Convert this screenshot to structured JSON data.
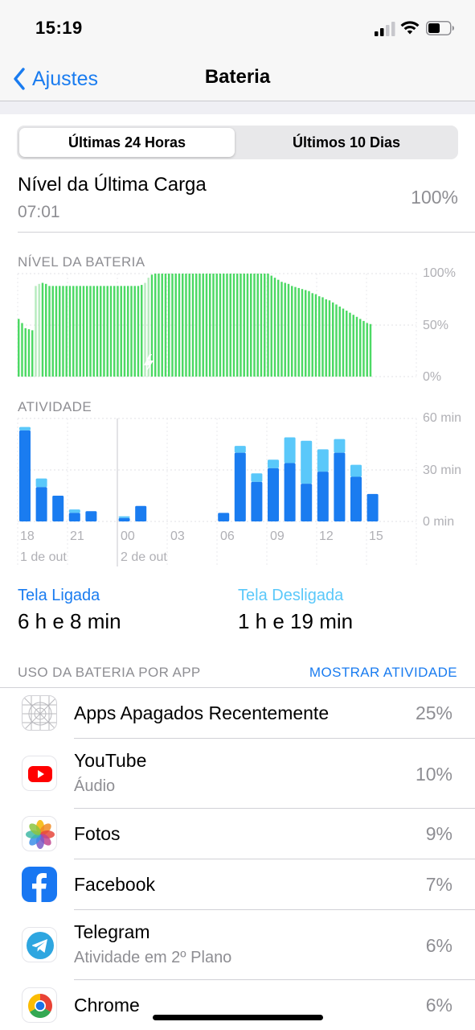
{
  "status": {
    "time": "15:19"
  },
  "nav": {
    "back_label": "Ajustes",
    "title": "Bateria"
  },
  "segments": {
    "active": "Últimas 24 Horas",
    "inactive": "Últimos 10 Dias"
  },
  "last_charge": {
    "title": "Nível da Última Carga",
    "time": "07:01",
    "value": "100%"
  },
  "battery_chart": {
    "section_label": "NÍVEL DA BATERIA",
    "y_labels": [
      "100%",
      "50%",
      "0%"
    ]
  },
  "activity_chart": {
    "section_label": "ATIVIDADE",
    "y_labels": [
      "60 min",
      "30 min",
      "0 min"
    ],
    "x_labels": [
      "18",
      "21",
      "00",
      "03",
      "06",
      "09",
      "12",
      "15"
    ],
    "date_labels": [
      "1 de out",
      "2 de out"
    ]
  },
  "usage": {
    "screen_on_label": "Tela Ligada",
    "screen_on_value": "6 h e 8 min",
    "screen_off_label": "Tela Desligada",
    "screen_off_value": "1 h e 19 min"
  },
  "apps_section": {
    "header": "USO DA BATERIA POR APP",
    "action": "MOSTRAR ATIVIDADE"
  },
  "apps": [
    {
      "name": "Apps Apagados Recentemente",
      "sub": "",
      "pct": "25%",
      "icon": "deleted-apps-icon"
    },
    {
      "name": "YouTube",
      "sub": "Áudio",
      "pct": "10%",
      "icon": "youtube-icon"
    },
    {
      "name": "Fotos",
      "sub": "",
      "pct": "9%",
      "icon": "photos-icon"
    },
    {
      "name": "Facebook",
      "sub": "",
      "pct": "7%",
      "icon": "facebook-icon"
    },
    {
      "name": "Telegram",
      "sub": "Atividade em 2º Plano",
      "pct": "6%",
      "icon": "telegram-icon"
    },
    {
      "name": "Chrome",
      "sub": "",
      "pct": "6%",
      "icon": "chrome-icon"
    }
  ],
  "colors": {
    "accent": "#1a7cf0",
    "battery_green": "#4cd964",
    "screen_on": "#1a7cf0",
    "screen_off": "#5ac8fa"
  },
  "chart_data": [
    {
      "type": "bar",
      "title": "NÍVEL DA BATERIA",
      "ylim": [
        0,
        100
      ],
      "y_ticks": [
        "100%",
        "50%",
        "0%"
      ],
      "note_charging": "charging periods around bars 5-6 and 37-38",
      "values": [
        56,
        52,
        47,
        46,
        45,
        88,
        90,
        91,
        90,
        88,
        88,
        88,
        88,
        88,
        88,
        88,
        88,
        88,
        88,
        88,
        88,
        88,
        88,
        88,
        88,
        88,
        88,
        88,
        88,
        88,
        88,
        88,
        88,
        88,
        88,
        88,
        89,
        91,
        96,
        99,
        100,
        100,
        100,
        100,
        100,
        100,
        100,
        100,
        100,
        100,
        100,
        100,
        100,
        100,
        100,
        100,
        100,
        100,
        100,
        100,
        100,
        100,
        100,
        100,
        100,
        100,
        100,
        100,
        100,
        100,
        100,
        100,
        100,
        100,
        98,
        96,
        94,
        92,
        91,
        90,
        88,
        87,
        86,
        85,
        84,
        83,
        81,
        80,
        78,
        77,
        75,
        74,
        72,
        70,
        68,
        66,
        64,
        62,
        60,
        58,
        56,
        54,
        52,
        51
      ]
    },
    {
      "type": "bar",
      "title": "ATIVIDADE",
      "ylim": [
        0,
        60
      ],
      "categories": [
        "18",
        "19",
        "20",
        "21",
        "22",
        "23",
        "00",
        "01",
        "02",
        "03",
        "04",
        "05",
        "06",
        "07",
        "08",
        "09",
        "10",
        "11",
        "12",
        "13",
        "14",
        "15"
      ],
      "series": [
        {
          "name": "Tela Ligada",
          "values": [
            53,
            20,
            15,
            5,
            6,
            0,
            2,
            9,
            0,
            0,
            0,
            0,
            5,
            40,
            23,
            31,
            34,
            22,
            29,
            40,
            26,
            16
          ]
        },
        {
          "name": "Tela Desligada",
          "values": [
            2,
            5,
            0,
            2,
            0,
            0,
            1,
            0,
            0,
            0,
            0,
            0,
            0,
            4,
            5,
            5,
            15,
            25,
            13,
            8,
            7,
            0
          ]
        }
      ]
    }
  ]
}
